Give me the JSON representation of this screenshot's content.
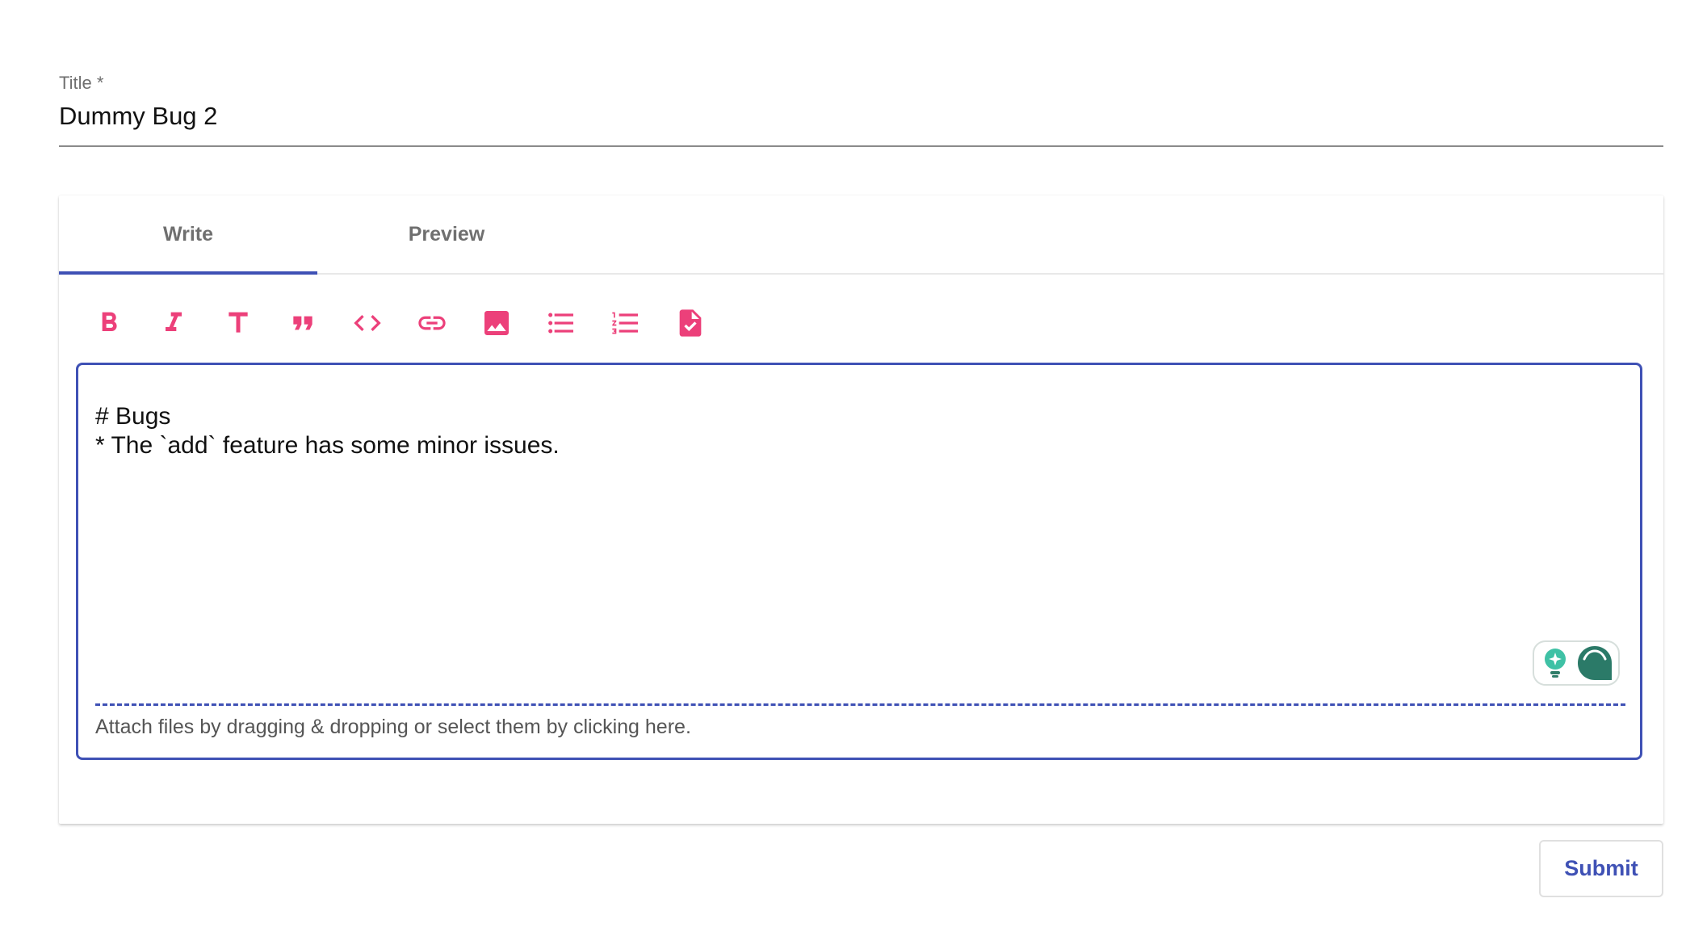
{
  "title_field": {
    "label": "Title *",
    "value": "Dummy Bug 2"
  },
  "tabs": [
    {
      "label": "Write",
      "active": true
    },
    {
      "label": "Preview",
      "active": false
    }
  ],
  "toolbar": {
    "accent_color": "#ec407a",
    "tools": [
      {
        "name": "bold",
        "icon": "bold-icon"
      },
      {
        "name": "italic",
        "icon": "italic-icon"
      },
      {
        "name": "header",
        "icon": "text-heading-icon"
      },
      {
        "name": "quote",
        "icon": "quote-icon"
      },
      {
        "name": "code",
        "icon": "code-icon"
      },
      {
        "name": "link",
        "icon": "link-icon"
      },
      {
        "name": "image",
        "icon": "image-icon"
      },
      {
        "name": "unordered-list",
        "icon": "bullet-list-icon"
      },
      {
        "name": "ordered-list",
        "icon": "numbered-list-icon"
      },
      {
        "name": "checked-list",
        "icon": "checklist-document-icon"
      }
    ]
  },
  "editor": {
    "content": "# Bugs\n* The `add` feature has some minor issues.",
    "attach_hint": "Attach files by dragging & dropping or select them by clicking here.",
    "border_color": "#3f51b5"
  },
  "assistant_widget": {
    "icons": [
      "lightbulb-icon",
      "chat-bubble-icon"
    ]
  },
  "submit": {
    "label": "Submit"
  }
}
